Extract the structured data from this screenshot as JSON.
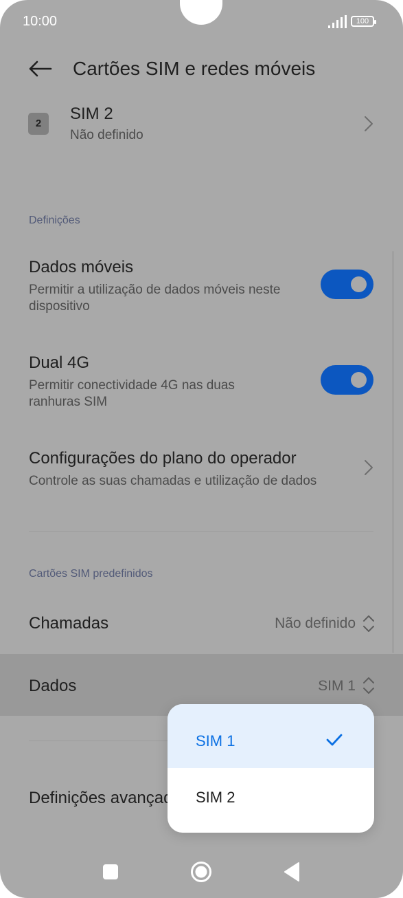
{
  "status_bar": {
    "time": "10:00",
    "battery": "100"
  },
  "header": {
    "title": "Cartões SIM e redes móveis"
  },
  "sim2": {
    "chip": "2",
    "title": "SIM 2",
    "subtitle": "Não definido"
  },
  "settings_section": {
    "label": "Definições"
  },
  "mobile_data": {
    "title": "Dados móveis",
    "subtitle": "Permitir a utilização de dados móveis neste dispositivo",
    "enabled": true
  },
  "dual_4g": {
    "title": "Dual 4G",
    "subtitle": "Permitir conectividade 4G nas duas ranhuras SIM",
    "enabled": true
  },
  "carrier_plan": {
    "title": "Configurações do plano do operador",
    "subtitle": "Controle as suas chamadas e utilização de dados"
  },
  "default_sim_section": {
    "label": "Cartões SIM predefinidos"
  },
  "calls": {
    "title": "Chamadas",
    "value": "Não definido"
  },
  "data": {
    "title": "Dados",
    "value": "SIM 1"
  },
  "advanced": {
    "title": "Definições avançadas"
  },
  "popup": {
    "options": [
      {
        "label": "SIM 1",
        "selected": true
      },
      {
        "label": "SIM 2",
        "selected": false
      }
    ]
  },
  "colors": {
    "accent": "#0b70e3",
    "toggle": "#0c57c0"
  }
}
